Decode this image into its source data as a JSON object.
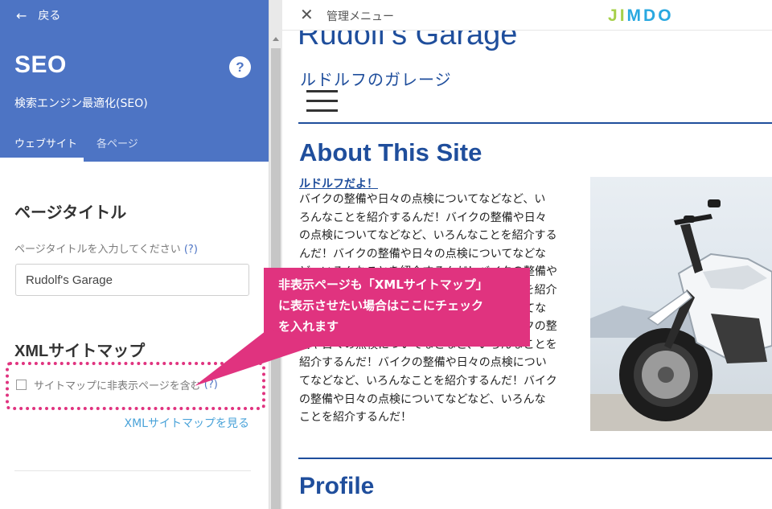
{
  "sidebar": {
    "back_label": "戻る",
    "title": "SEO",
    "help": "?",
    "subtitle": "検索エンジン最適化(SEO)",
    "tabs": [
      {
        "label": "ウェブサイト",
        "active": true
      },
      {
        "label": "各ページ",
        "active": false
      }
    ],
    "page_title_section": {
      "heading": "ページタイトル",
      "label": "ページタイトルを入力してください",
      "help": "(?)",
      "value": "Rudolf's Garage"
    },
    "xml_section": {
      "heading": "XMLサイトマップ",
      "checkbox_label": "サイトマップに非表示ページを含む",
      "checked": false,
      "help": "(?)",
      "link": "XMLサイトマップを見る"
    }
  },
  "admin_bar": {
    "close": "✕",
    "menu_label": "管理メニュー",
    "logo": [
      "J",
      "I",
      "M",
      "D",
      "O"
    ],
    "logo_colors": [
      "#a6d04a",
      "#a6d04a",
      "#29a8e0",
      "#29a8e0",
      "#29a8e0"
    ]
  },
  "site": {
    "title": "Rudolf's Garage",
    "subtitle": "ルドルフのガレージ",
    "about_heading": "About This Site",
    "link_text": "ルドルフだよ！",
    "body_lines": [
      "バイクの整備や日々の点検についてなどなど、い",
      "ろんなことを紹介するんだ！バイクの整備や日々",
      "の点検についてなどなど、いろんなことを紹介する",
      "んだ！バイクの整備や日々の点検についてなどな",
      "ど、いろんなことを紹介するんだ！バイクの整備や",
      "日々の点検についてなどなど、いろんなことを紹介",
      "するんだ！バイクの整備や日々の点検についてな",
      "どなど、いろんなことを紹介するんだ！バイクの整",
      "備や日々の点検についてなどなど、いろんなことを",
      "紹介するんだ！バイクの整備や日々の点検につい",
      "てなどなど、いろんなことを紹介するんだ！バイク",
      "の整備や日々の点検についてなどなど、いろんな",
      "ことを紹介するんだ！"
    ],
    "profile_heading": "Profile"
  },
  "callout": {
    "lines": [
      "非表示ページも「XMLサイトマップ」",
      "に表示させたい場合はここにチェック",
      "を入れます"
    ]
  },
  "colors": {
    "sidebar_header": "#4d74c4",
    "site_blue": "#1f4e9c",
    "callout_pink": "#e0337f",
    "link_blue": "#4aa3d9"
  }
}
